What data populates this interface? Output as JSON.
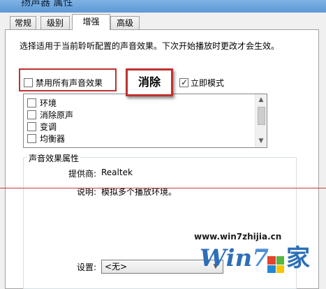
{
  "window": {
    "title": "扬声器 属性"
  },
  "tabs": [
    {
      "label": "常规",
      "active": false
    },
    {
      "label": "级别",
      "active": false
    },
    {
      "label": "增强",
      "active": true
    },
    {
      "label": "高级",
      "active": false
    }
  ],
  "description": "选择适用于当前聆听配置的声音效果。下次开始播放时更改才会生效。",
  "disable_all": {
    "label": "禁用所有声音效果",
    "checked": false
  },
  "callout": {
    "label": "消除"
  },
  "immediate_mode": {
    "label": "立即模式",
    "checked": true
  },
  "effects": [
    {
      "label": "环境",
      "checked": false
    },
    {
      "label": "消除原声",
      "checked": false
    },
    {
      "label": "变调",
      "checked": false
    },
    {
      "label": "均衡器",
      "checked": false
    }
  ],
  "properties": {
    "group_label": "声音效果属性",
    "provider_label": "提供商:",
    "provider_value": "Realtek",
    "description_label": "说明:",
    "description_value": "模拟多个播放环境。",
    "settings_label": "设置:",
    "settings_value": "<无>"
  },
  "watermark": {
    "url": "www.win7zhijia.cn",
    "logo_prefix": "Win",
    "logo_seven": "7",
    "logo_suffix": "家"
  },
  "colors": {
    "annotation_red": "#c0312e",
    "logo_blue": "#2d6fb8"
  }
}
